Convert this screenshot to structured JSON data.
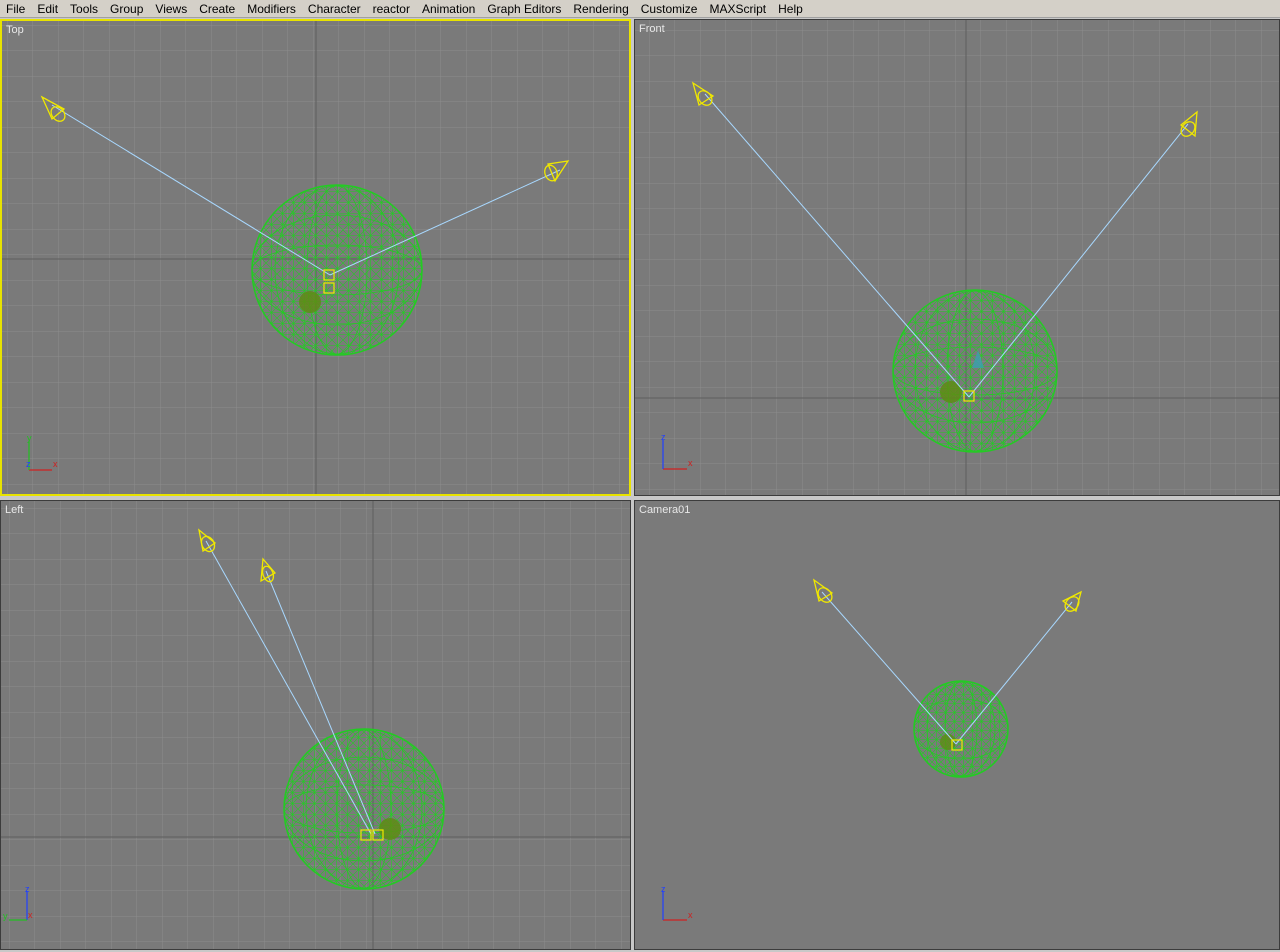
{
  "menubar": {
    "items": [
      "File",
      "Edit",
      "Tools",
      "Group",
      "Views",
      "Create",
      "Modifiers",
      "Character",
      "reactor",
      "Animation",
      "Graph Editors",
      "Rendering",
      "Customize",
      "MAXScript",
      "Help"
    ]
  },
  "viewports": {
    "top": {
      "label": "Top",
      "axes": {
        "v": "y",
        "h": "x",
        "depth": "z"
      }
    },
    "front": {
      "label": "Front",
      "axes": {
        "v": "z",
        "h": "x"
      }
    },
    "left": {
      "label": "Left",
      "axes": {
        "v": "z",
        "h": "x",
        "depth": "y"
      }
    },
    "camera": {
      "label": "Camera01",
      "axes": {
        "v": "z",
        "h": "x"
      }
    }
  },
  "colors": {
    "viewport_bg": "#7a7a7a",
    "grid": "#8c8c8c",
    "active_border": "#e8e300",
    "mesh": "#22cc22",
    "light": "#f0e800",
    "target_line": "#a8d8ff"
  }
}
